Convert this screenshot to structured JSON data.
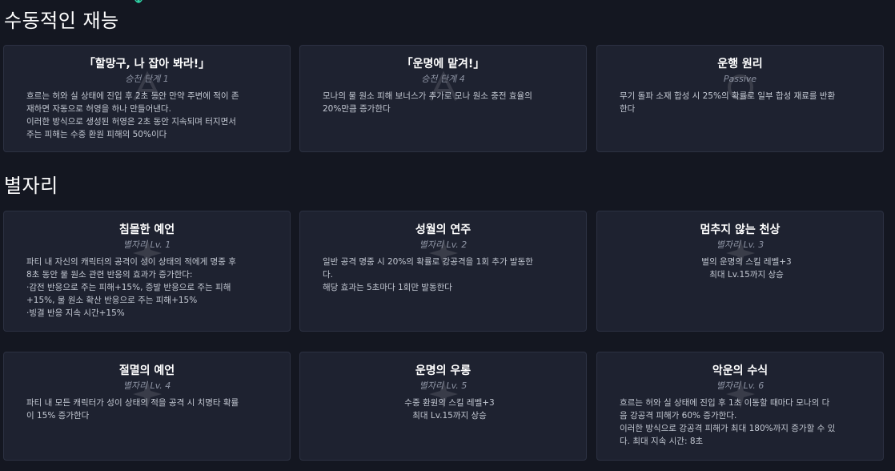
{
  "sections": {
    "talents_title": "수동적인 재능",
    "constellations_title": "별자리"
  },
  "talents": [
    {
      "title": "「할망구, 나 잡아 봐라!」",
      "sub": "승천 단계 1",
      "lines": [
        "흐르는 허와 실 상태에 진입 후 2초 동안 만약 주변에 적이 존",
        "재하면 자동으로 허영을 하나 만들어낸다.",
        "이러한 방식으로 생성된 허영은 2초 동안 지속되며 터지면서",
        "주는 피해는 수중 환원 피해의 50%이다"
      ]
    },
    {
      "title": "「운명에 맡겨!」",
      "sub": "승천 단계 4",
      "lines": [
        "모나의 물 원소 피해 보너스가 추가로 모나 원소 충전 효율의",
        "20%만큼 증가한다"
      ]
    },
    {
      "title": "운행 원리",
      "sub": "Passive",
      "lines": [
        "무기 돌파 소재 합성 시 25%의 확률로 일부 합성 재료를 반환",
        "한다"
      ]
    }
  ],
  "constellations": [
    {
      "title": "침몰한 예언",
      "sub": "별자리 Lv. 1",
      "lines": [
        "파티 내 자신의 캐릭터의 공격이 성이 상태의 적에게 명중 후",
        "8초 동안 물 원소 관련 반응의 효과가 증가한다:",
        "·감전 반응으로 주는 피해+15%, 증발 반응으로 주는 피해",
        "+15%, 물 원소 확산 반응으로 주는 피해+15%",
        "·빙결 반응 지속 시간+15%"
      ]
    },
    {
      "title": "성월의 연주",
      "sub": "별자리 Lv. 2",
      "lines": [
        "일반 공격 명중 시 20%의 확률로 강공격을 1회 추가 발동한",
        "다.",
        "해당 효과는 5초마다 1회만 발동한다"
      ]
    },
    {
      "title": "멈추지 않는 천상",
      "sub": "별자리 Lv. 3",
      "lines": [
        "별의 운명의 스킬 레벨+3",
        "최대 Lv.15까지 상승"
      ]
    },
    {
      "title": "절멸의 예언",
      "sub": "별자리 Lv. 4",
      "lines": [
        "파티 내 모든 캐릭터가 성이 상태의 적을 공격 시 치명타 확률",
        "이 15% 증가한다"
      ]
    },
    {
      "title": "운명의 우롱",
      "sub": "별자리 Lv. 5",
      "lines": [
        "수중 환원의 스킬 레벨+3",
        "최대 Lv.15까지 상승"
      ]
    },
    {
      "title": "악운의 수식",
      "sub": "별자리 Lv. 6",
      "lines": [
        "흐르는 허와 실 상태에 진입 후 1초 이동할 때마다 모나의 다",
        "음 강공격 피해가 60% 증가한다.",
        "이러한 방식으로 강공격 피해가 최대 180%까지 증가할 수 있",
        "다. 최대 지속 시간: 8초"
      ]
    }
  ]
}
